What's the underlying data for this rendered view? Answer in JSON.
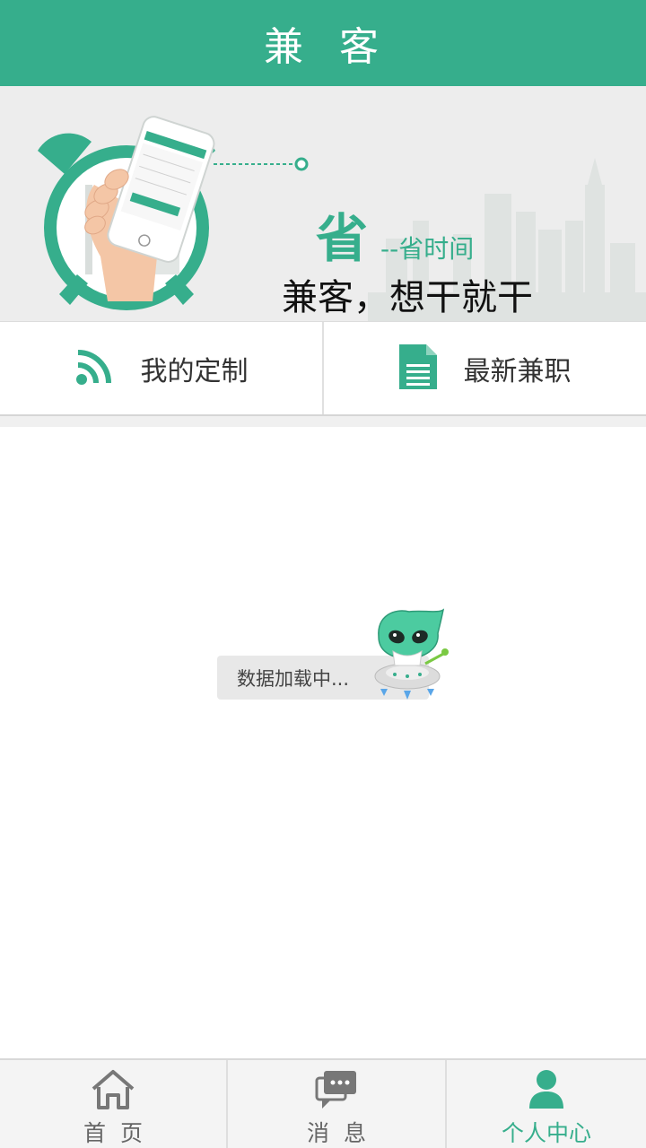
{
  "header": {
    "title": "兼  客"
  },
  "banner": {
    "sheng_char": "省",
    "sheng_sub": "--省时间",
    "slogan": "兼客，想干就干"
  },
  "menu": [
    {
      "label": "我的定制",
      "icon": "rss-icon"
    },
    {
      "label": "最新兼职",
      "icon": "document-icon"
    }
  ],
  "loading": {
    "text": "数据加载中..."
  },
  "tabs": [
    {
      "label": "首  页",
      "icon": "home-icon",
      "active": false
    },
    {
      "label": "消  息",
      "icon": "message-icon",
      "active": false
    },
    {
      "label": "个人中心",
      "icon": "person-icon",
      "active": true
    }
  ],
  "colors": {
    "accent": "#36ae8c",
    "background": "#ffffff",
    "tabbar": "#f4f4f4"
  }
}
